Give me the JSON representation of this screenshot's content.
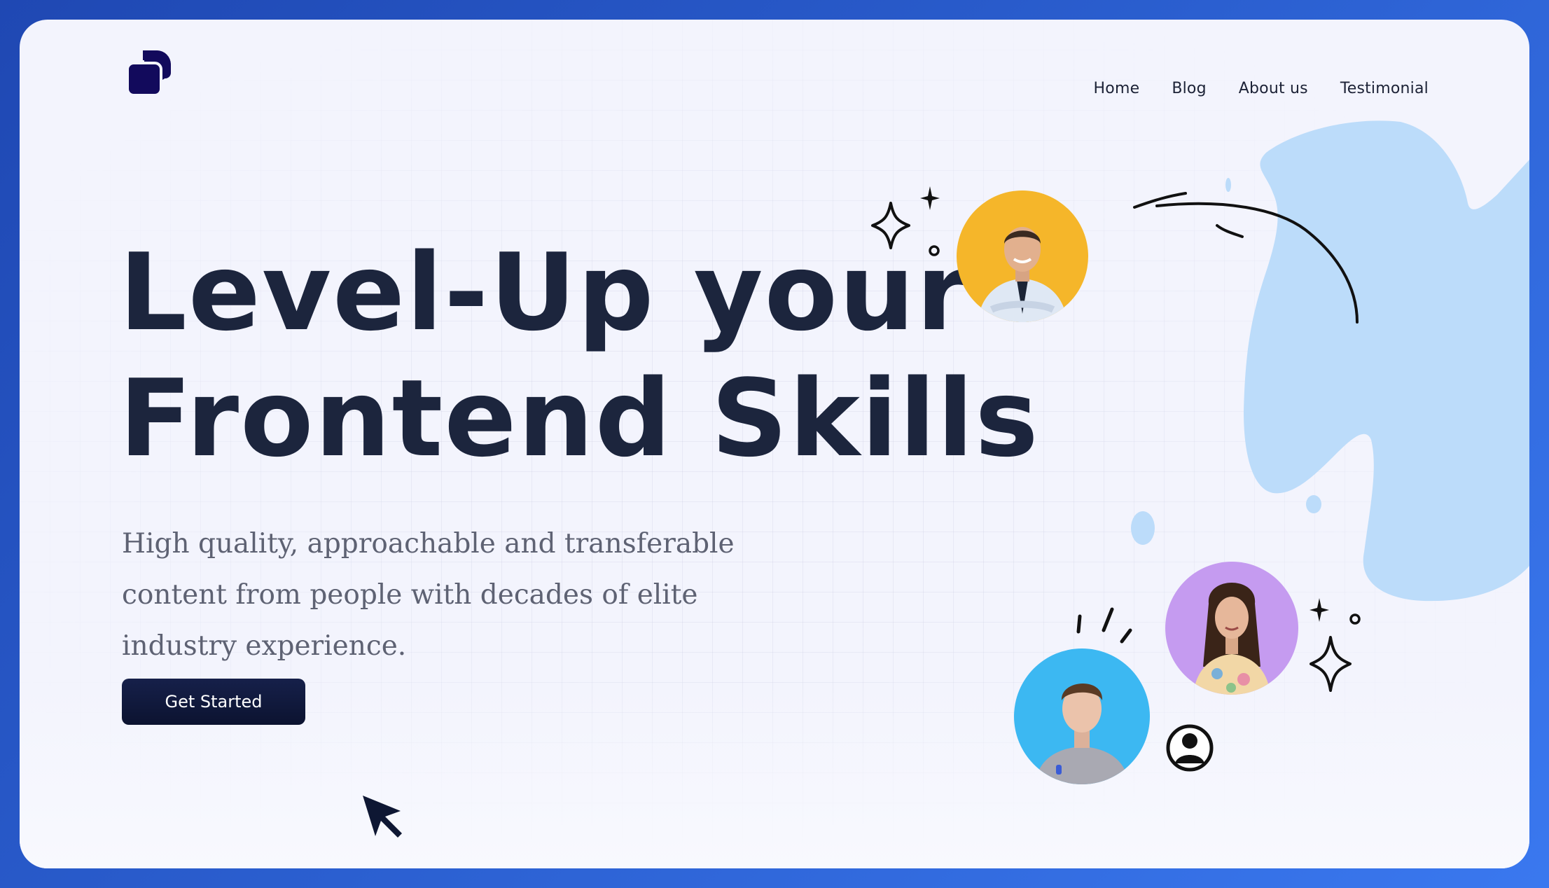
{
  "brand": {
    "logo_icon": "stacked-squares-logo",
    "color": "#120a5c"
  },
  "nav": {
    "items": [
      {
        "label": "Home"
      },
      {
        "label": "Blog"
      },
      {
        "label": "About us"
      },
      {
        "label": "Testimonial"
      }
    ]
  },
  "hero": {
    "headline_line1": "Level-Up your",
    "headline_line2": "Frontend Skills",
    "subtitle": "High quality, approachable and transferable content from people with decades of elite industry experience.",
    "cta_label": "Get Started"
  },
  "colors": {
    "frame_border": "#2b5fd0",
    "background": "#f3f4fd",
    "headline": "#1c253d",
    "cta": "#0f1737",
    "blob": "#bcdcfa",
    "avatar_yellow": "#f5b62a",
    "avatar_purple": "#c59bf0",
    "avatar_blue": "#3cb8f2"
  },
  "icons": [
    "sparkle-icon",
    "user-circle-icon",
    "cursor-arrow-icon"
  ]
}
